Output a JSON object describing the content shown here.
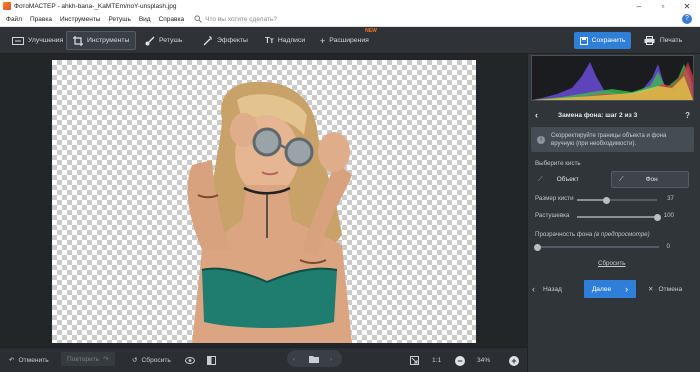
{
  "window": {
    "title": "ФотоМАСТЕР - ahkh-bana-_KaMTEm/noY-unsplash.jpg"
  },
  "menu": {
    "items": [
      "Файл",
      "Правка",
      "Инструменты",
      "Ретушь",
      "Вид",
      "Справка"
    ],
    "search_placeholder": "Что вы хотите сделать?"
  },
  "toolbar": {
    "tabs": [
      "Улучшения",
      "Инструменты",
      "Ретушь",
      "Эффекты",
      "Надписи",
      "Расширения"
    ],
    "new_badge": "NEW",
    "save_label": "Сохранить",
    "print_label": "Печать"
  },
  "panel": {
    "step_title": "Замена фона: шаг 2 из 3",
    "info_text_1": "Скорректируйте границы объекта и фона",
    "info_text_2": "вручную (при необходимости).",
    "brush_label": "Выберите кисть",
    "brush_object": "Объект",
    "brush_background": "Фон",
    "size_label": "Размер кисти",
    "size_value": "37",
    "feather_label": "Растушевка",
    "feather_value": "100",
    "transparency_label": "Прозрачность фона",
    "transparency_hint": "(в предпросмотре)",
    "transparency_value": "0",
    "reset_link": "Сбросить",
    "back_label": "Назад",
    "next_label": "Далее",
    "cancel_label": "Отмена",
    "size_level": 0.37,
    "feather_level": 1.0,
    "transparency_level": 0.0
  },
  "bottombar": {
    "undo": "Отменить",
    "redo": "Повторить",
    "reset": "Сбросить",
    "ratio": "1:1",
    "zoom": "34%"
  },
  "colors": {
    "accent": "#2f7fd8",
    "panel": "#30353a",
    "badge": "#e8782a"
  }
}
